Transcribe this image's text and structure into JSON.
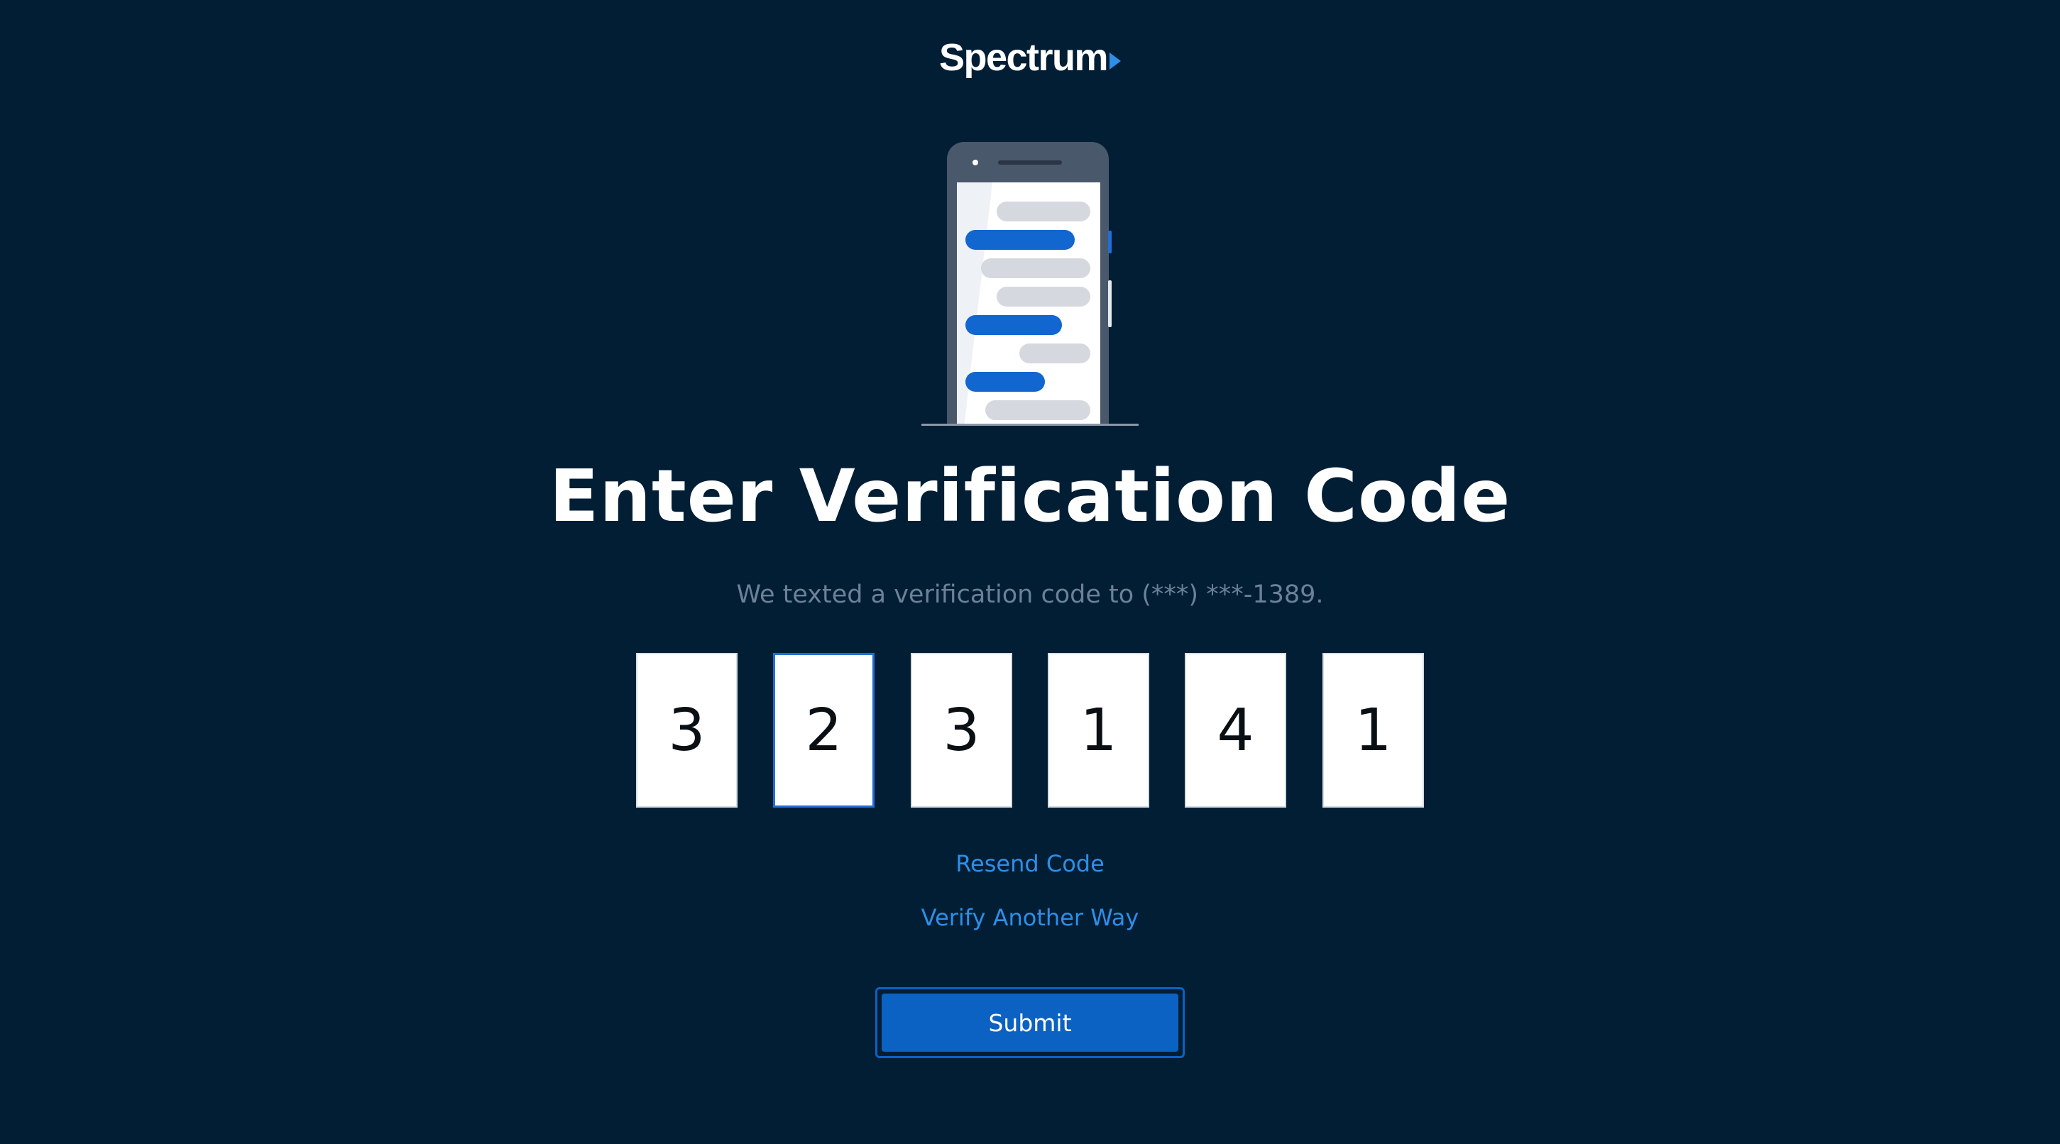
{
  "brand": {
    "logo_text": "Spectrum",
    "accent_color": "#2d8fe8",
    "background_color": "#011e35",
    "button_color": "#0b62c2"
  },
  "illustration": {
    "icon": "phone-messages-icon"
  },
  "heading": {
    "title": "Enter Verification Code",
    "subtitle": "We texted a verification code to (***) ***-1389."
  },
  "code": {
    "digits": [
      "3",
      "2",
      "3",
      "1",
      "4",
      "1"
    ],
    "focused_index": 1
  },
  "links": {
    "resend": "Resend Code",
    "verify_another": "Verify Another Way"
  },
  "actions": {
    "submit_label": "Submit"
  }
}
